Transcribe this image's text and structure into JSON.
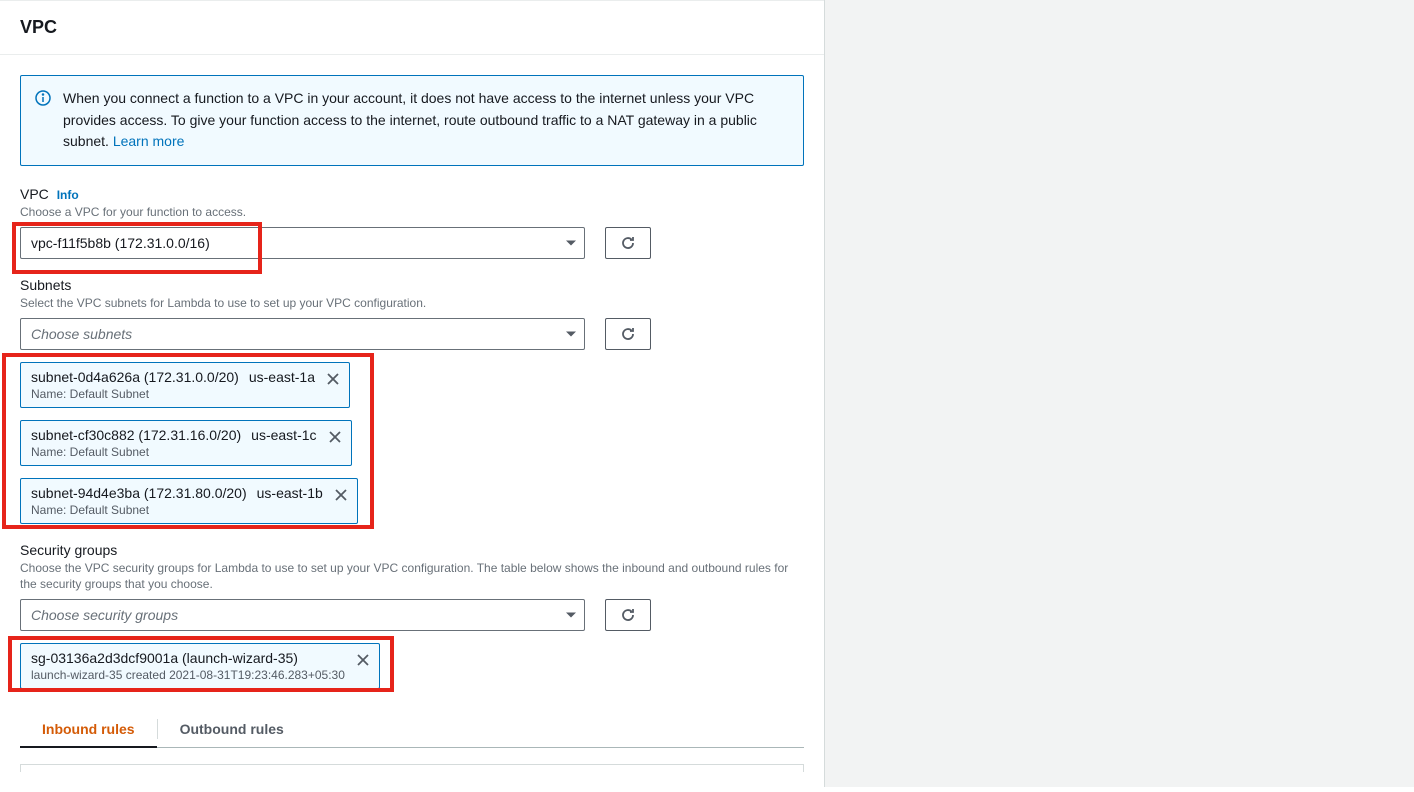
{
  "panel": {
    "title": "VPC"
  },
  "info_box": {
    "text": "When you connect a function to a VPC in your account, it does not have access to the internet unless your VPC provides access. To give your function access to the internet, route outbound traffic to a NAT gateway in a public subnet. ",
    "link": "Learn more"
  },
  "vpc_field": {
    "label": "VPC",
    "info": "Info",
    "desc": "Choose a VPC for your function to access.",
    "value": "vpc-f11f5b8b (172.31.0.0/16)"
  },
  "subnets_field": {
    "label": "Subnets",
    "desc": "Select the VPC subnets for Lambda to use to set up your VPC configuration.",
    "placeholder": "Choose subnets"
  },
  "subnets": [
    {
      "id": "subnet-0d4a626a (172.31.0.0/20)",
      "az": "us-east-1a",
      "sub": "Name: Default Subnet"
    },
    {
      "id": "subnet-cf30c882 (172.31.16.0/20)",
      "az": "us-east-1c",
      "sub": "Name: Default Subnet"
    },
    {
      "id": "subnet-94d4e3ba (172.31.80.0/20)",
      "az": "us-east-1b",
      "sub": "Name: Default Subnet"
    }
  ],
  "sg_field": {
    "label": "Security groups",
    "desc": "Choose the VPC security groups for Lambda to use to set up your VPC configuration. The table below shows the inbound and outbound rules for the security groups that you choose.",
    "placeholder": "Choose security groups"
  },
  "sgs": [
    {
      "id": "sg-03136a2d3dcf9001a (launch-wizard-35)",
      "sub": "launch-wizard-35 created 2021-08-31T19:23:46.283+05:30"
    }
  ],
  "tabs": {
    "inbound": "Inbound rules",
    "outbound": "Outbound rules"
  }
}
